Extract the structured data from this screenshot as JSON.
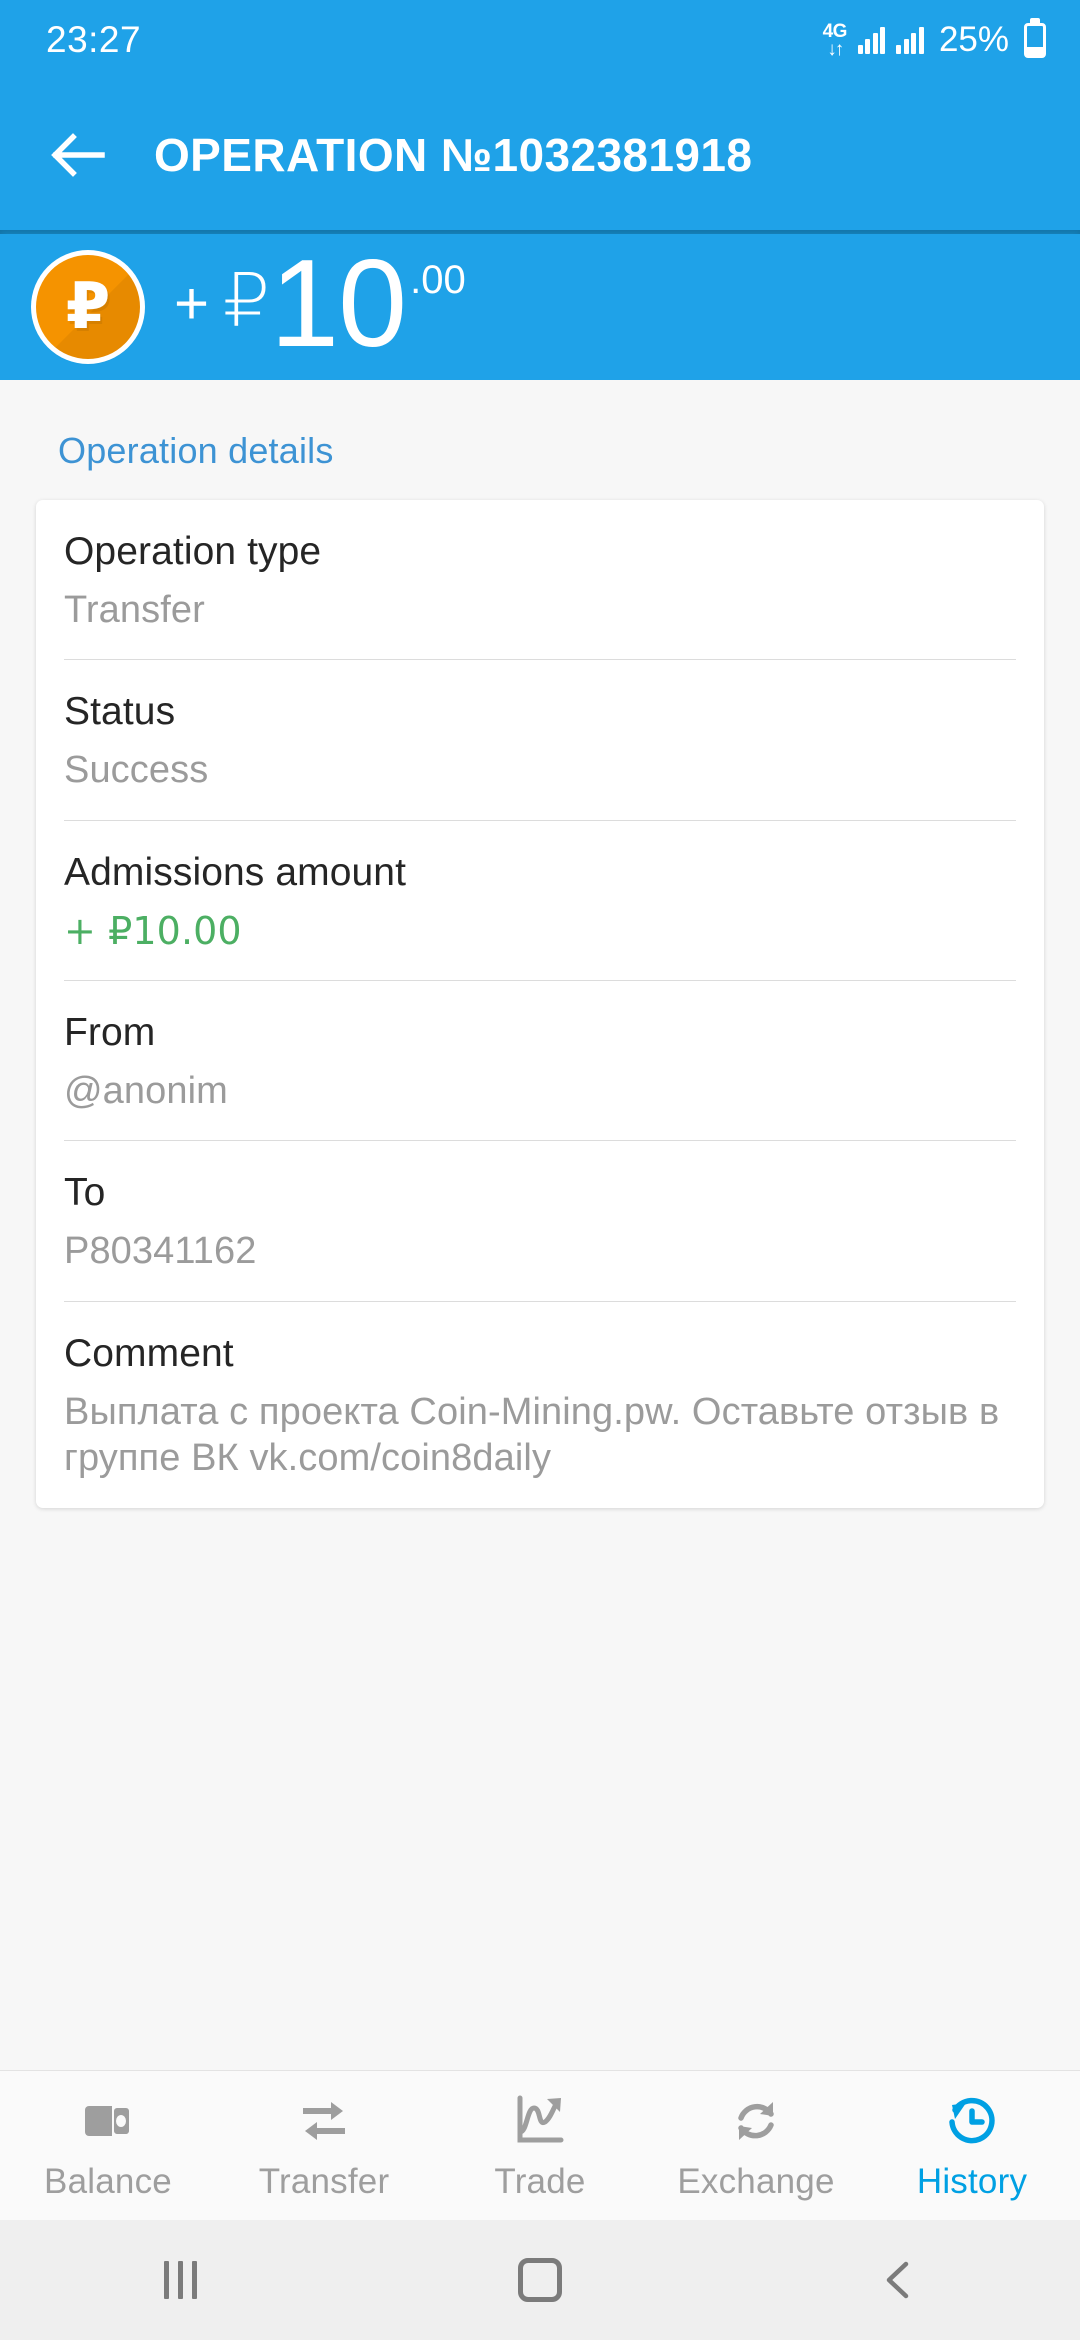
{
  "statusbar": {
    "time": "23:27",
    "network_type": "4G",
    "network_arrows": "↓↑",
    "battery_percent": "25%",
    "battery_level": 25,
    "signal_icon": "signal-bars-icon",
    "battery_icon": "battery-icon"
  },
  "appbar": {
    "back_icon": "back-arrow-icon",
    "title": "OPERATION №1032381918",
    "background_color": "#1FA2E8"
  },
  "amount_header": {
    "coin_icon": "ruble-coin-icon",
    "coin_symbol": "₽",
    "coin_color": "#F59300",
    "sign": "+",
    "currency": "₽",
    "integer": "10",
    "decimal": ".00"
  },
  "main": {
    "section_title": "Operation details",
    "section_title_color": "#3D93D4",
    "rows": [
      {
        "label": "Operation type",
        "value": "Transfer",
        "style": "muted"
      },
      {
        "label": "Status",
        "value": "Success",
        "style": "muted"
      },
      {
        "label": "Admissions amount",
        "value": "+ ₽10.00",
        "style": "positive"
      },
      {
        "label": "From",
        "value": "@anonim",
        "style": "muted"
      },
      {
        "label": "To",
        "value": "P80341162",
        "style": "muted"
      },
      {
        "label": "Comment",
        "value": "Выплата с проекта Coin-Mining.pw. Оставьте отзыв в группе ВК vk.com/coin8daily",
        "style": "muted"
      }
    ],
    "positive_color": "#4CAF63"
  },
  "bottomnav": {
    "active_color": "#00A0E3",
    "inactive_color": "#9E9E9E",
    "items": [
      {
        "label": "Balance",
        "icon": "wallet-icon",
        "active": false
      },
      {
        "label": "Transfer",
        "icon": "transfer-icon",
        "active": false
      },
      {
        "label": "Trade",
        "icon": "chart-up-icon",
        "active": false
      },
      {
        "label": "Exchange",
        "icon": "refresh-icon",
        "active": false
      },
      {
        "label": "History",
        "icon": "history-clock-icon",
        "active": true
      }
    ]
  },
  "sysnav": {
    "recent_icon": "recents-icon",
    "home_icon": "home-icon",
    "back_icon": "system-back-icon"
  }
}
